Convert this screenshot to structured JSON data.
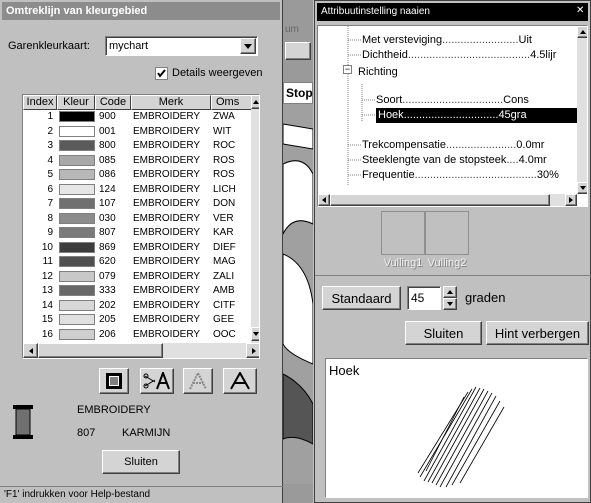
{
  "left_dialog": {
    "title": "Omtreklijn van kleurgebied",
    "chart_label": "Garenkleurkaart:",
    "chart_value": "mychart",
    "details_label": "Details weergeven",
    "columns": [
      "Index",
      "Kleur",
      "Code",
      "Merk",
      "Oms"
    ],
    "rows": [
      {
        "index": "1",
        "color": "#000000",
        "code": "900",
        "brand": "EMBROIDERY",
        "desc": "ZWA"
      },
      {
        "index": "2",
        "color": "#ffffff",
        "code": "001",
        "brand": "EMBROIDERY",
        "desc": "WIT"
      },
      {
        "index": "3",
        "color": "#5a5a5a",
        "code": "800",
        "brand": "EMBROIDERY",
        "desc": "ROC"
      },
      {
        "index": "4",
        "color": "#a8a8a8",
        "code": "085",
        "brand": "EMBROIDERY",
        "desc": "ROS"
      },
      {
        "index": "5",
        "color": "#b8b8b8",
        "code": "086",
        "brand": "EMBROIDERY",
        "desc": "ROS"
      },
      {
        "index": "6",
        "color": "#e6e6e6",
        "code": "124",
        "brand": "EMBROIDERY",
        "desc": "LICH"
      },
      {
        "index": "7",
        "color": "#707070",
        "code": "107",
        "brand": "EMBROIDERY",
        "desc": "DON"
      },
      {
        "index": "8",
        "color": "#8c8c8c",
        "code": "030",
        "brand": "EMBROIDERY",
        "desc": "VER"
      },
      {
        "index": "9",
        "color": "#7a7a7a",
        "code": "807",
        "brand": "EMBROIDERY",
        "desc": "KAR"
      },
      {
        "index": "10",
        "color": "#3c3c3c",
        "code": "869",
        "brand": "EMBROIDERY",
        "desc": "DIEF"
      },
      {
        "index": "11",
        "color": "#505050",
        "code": "620",
        "brand": "EMBROIDERY",
        "desc": "MAG"
      },
      {
        "index": "12",
        "color": "#c8c8c8",
        "code": "079",
        "brand": "EMBROIDERY",
        "desc": "ZALI"
      },
      {
        "index": "13",
        "color": "#686868",
        "code": "333",
        "brand": "EMBROIDERY",
        "desc": "AMB"
      },
      {
        "index": "14",
        "color": "#d8d8d8",
        "code": "202",
        "brand": "EMBROIDERY",
        "desc": "CITF"
      },
      {
        "index": "15",
        "color": "#e0e0e0",
        "code": "205",
        "brand": "EMBROIDERY",
        "desc": "GEE"
      },
      {
        "index": "16",
        "color": "#cfcfcf",
        "code": "206",
        "brand": "EMBROIDERY",
        "desc": "OOC"
      }
    ],
    "selected_brand": "EMBROIDERY",
    "selected_code": "807",
    "selected_name": "KARMIJN",
    "close_label": "Sluiten"
  },
  "status_bar": "'F1' indrukken voor Help-bestand",
  "background_app": {
    "menu_text": "um",
    "toolbar_label": "Stop"
  },
  "right_panel": {
    "title": "Attribuutinstelling naaien",
    "tree": [
      {
        "label": "Met versteviging",
        "value": "Uit"
      },
      {
        "label": "Dichtheid",
        "value": "4.5lijr"
      },
      {
        "label": "Richting",
        "value": ""
      },
      {
        "label": "Soort",
        "value": "Cons"
      },
      {
        "label": "Hoek",
        "value": "45gra"
      },
      {
        "label": "Trekcompensatie",
        "value": "0.0mr"
      },
      {
        "label": "Steeklengte van de stopsteek",
        "value": "4.0mr"
      },
      {
        "label": "Frequentie",
        "value": "30%"
      }
    ],
    "preview_labels": [
      "Vulling1",
      "Vulling2"
    ],
    "default_label": "Standaard",
    "angle_value": "45",
    "unit_label": "graden",
    "close_label": "Sluiten",
    "hint_label": "Hint verbergen",
    "hint_title": "Hoek"
  }
}
